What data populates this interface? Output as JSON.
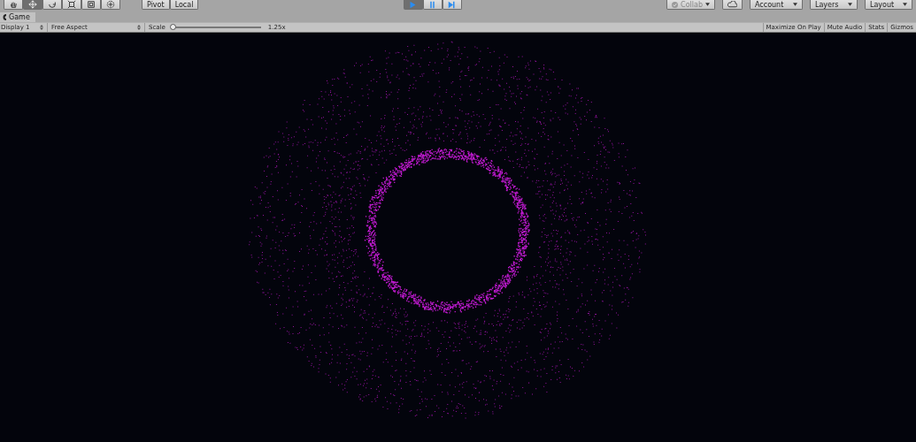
{
  "toolbar": {
    "tools": [
      {
        "kind": "hand",
        "selected": false
      },
      {
        "kind": "move",
        "selected": true
      },
      {
        "kind": "rotate",
        "selected": false
      },
      {
        "kind": "scale",
        "selected": false
      },
      {
        "kind": "rect",
        "selected": false
      },
      {
        "kind": "transform",
        "selected": false
      }
    ],
    "pivot": "Pivot",
    "local": "Local",
    "playback": [
      {
        "kind": "play",
        "on": true
      },
      {
        "kind": "pause",
        "on": false
      },
      {
        "kind": "step",
        "on": false
      }
    ],
    "collab": {
      "label": "Collab",
      "disabled": true
    },
    "account": "Account",
    "layers": "Layers",
    "layout": "Layout"
  },
  "game_tab": {
    "title": "Game"
  },
  "game_toolbar": {
    "display": "Display 1",
    "aspect": "Free Aspect",
    "scale_label": "Scale",
    "scale": {
      "level": 0
    },
    "scale_value": "1.25x",
    "toggles": [
      {
        "label": "Maximize On Play",
        "on": false
      },
      {
        "label": "Mute Audio",
        "on": false
      },
      {
        "label": "Stats",
        "on": false
      },
      {
        "label": "Gizmos",
        "on": false
      }
    ]
  }
}
